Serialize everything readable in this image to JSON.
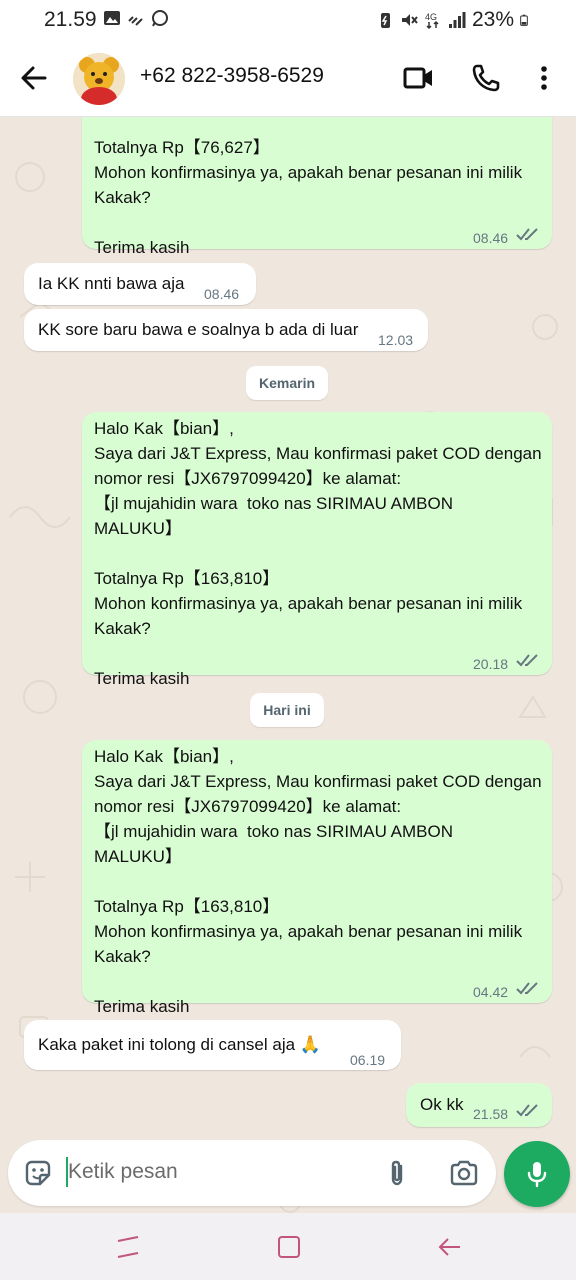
{
  "status_bar": {
    "time": "21.59",
    "battery": "23%",
    "icons": [
      "gallery-icon",
      "wifi-call-icon",
      "whatsapp-icon",
      "battery-saver-icon",
      "mute-icon",
      "network-4g-icon",
      "signal-icon",
      "battery-icon"
    ]
  },
  "header": {
    "contact": "+62 822-3958-6529",
    "icons": [
      "back-arrow-icon",
      "video-call-icon",
      "voice-call-icon",
      "more-options-icon"
    ]
  },
  "messages": [
    {
      "dir": "out",
      "text": "Totalnya Rp【76,627】\nMohon konfirmasinya ya, apakah benar pesanan ini milik Kakak?\n\nTerima kasih",
      "time": "08.46",
      "read": true
    },
    {
      "dir": "in",
      "text": "Ia KK nnti bawa aja",
      "time": "08.46"
    },
    {
      "dir": "in",
      "text": "KK sore baru bawa e soalnya b ada di luar",
      "time": "12.03"
    },
    {
      "dir": "day",
      "text": "Kemarin"
    },
    {
      "dir": "out",
      "text": "Halo Kak【bian】,\nSaya dari J&T Express, Mau konfirmasi paket COD dengan nomor resi【JX6797099420】ke alamat:\n【jl mujahidin wara  toko nas SIRIMAU AMBON MALUKU】\n\nTotalnya Rp【163,810】\nMohon konfirmasinya ya, apakah benar pesanan ini milik Kakak?\n\nTerima kasih",
      "time": "20.18",
      "read": true
    },
    {
      "dir": "day",
      "text": "Hari ini"
    },
    {
      "dir": "out",
      "text": "Halo Kak【bian】,\nSaya dari J&T Express, Mau konfirmasi paket COD dengan nomor resi【JX6797099420】ke alamat:\n【jl mujahidin wara  toko nas SIRIMAU AMBON MALUKU】\n\nTotalnya Rp【163,810】\nMohon konfirmasinya ya, apakah benar pesanan ini milik Kakak?\n\nTerima kasih",
      "time": "04.42",
      "read": true
    },
    {
      "dir": "in",
      "text": "Kaka paket ini tolong di cansel aja 🙏",
      "time": "06.19"
    },
    {
      "dir": "out",
      "text": "Ok kk",
      "time": "21.58",
      "read": true
    }
  ],
  "composer": {
    "placeholder": "Ketik pesan",
    "icons": [
      "sticker-icon",
      "attach-icon",
      "camera-icon",
      "mic-icon"
    ]
  },
  "nav": {
    "icons": [
      "recent-apps-icon",
      "home-icon",
      "back-icon"
    ]
  },
  "colors": {
    "accent": "#1daa61",
    "outgoing_bubble": "#d9fdd3",
    "incoming_bubble": "#ffffff",
    "chat_background": "#efe7de",
    "read_ticks": "#667781"
  }
}
